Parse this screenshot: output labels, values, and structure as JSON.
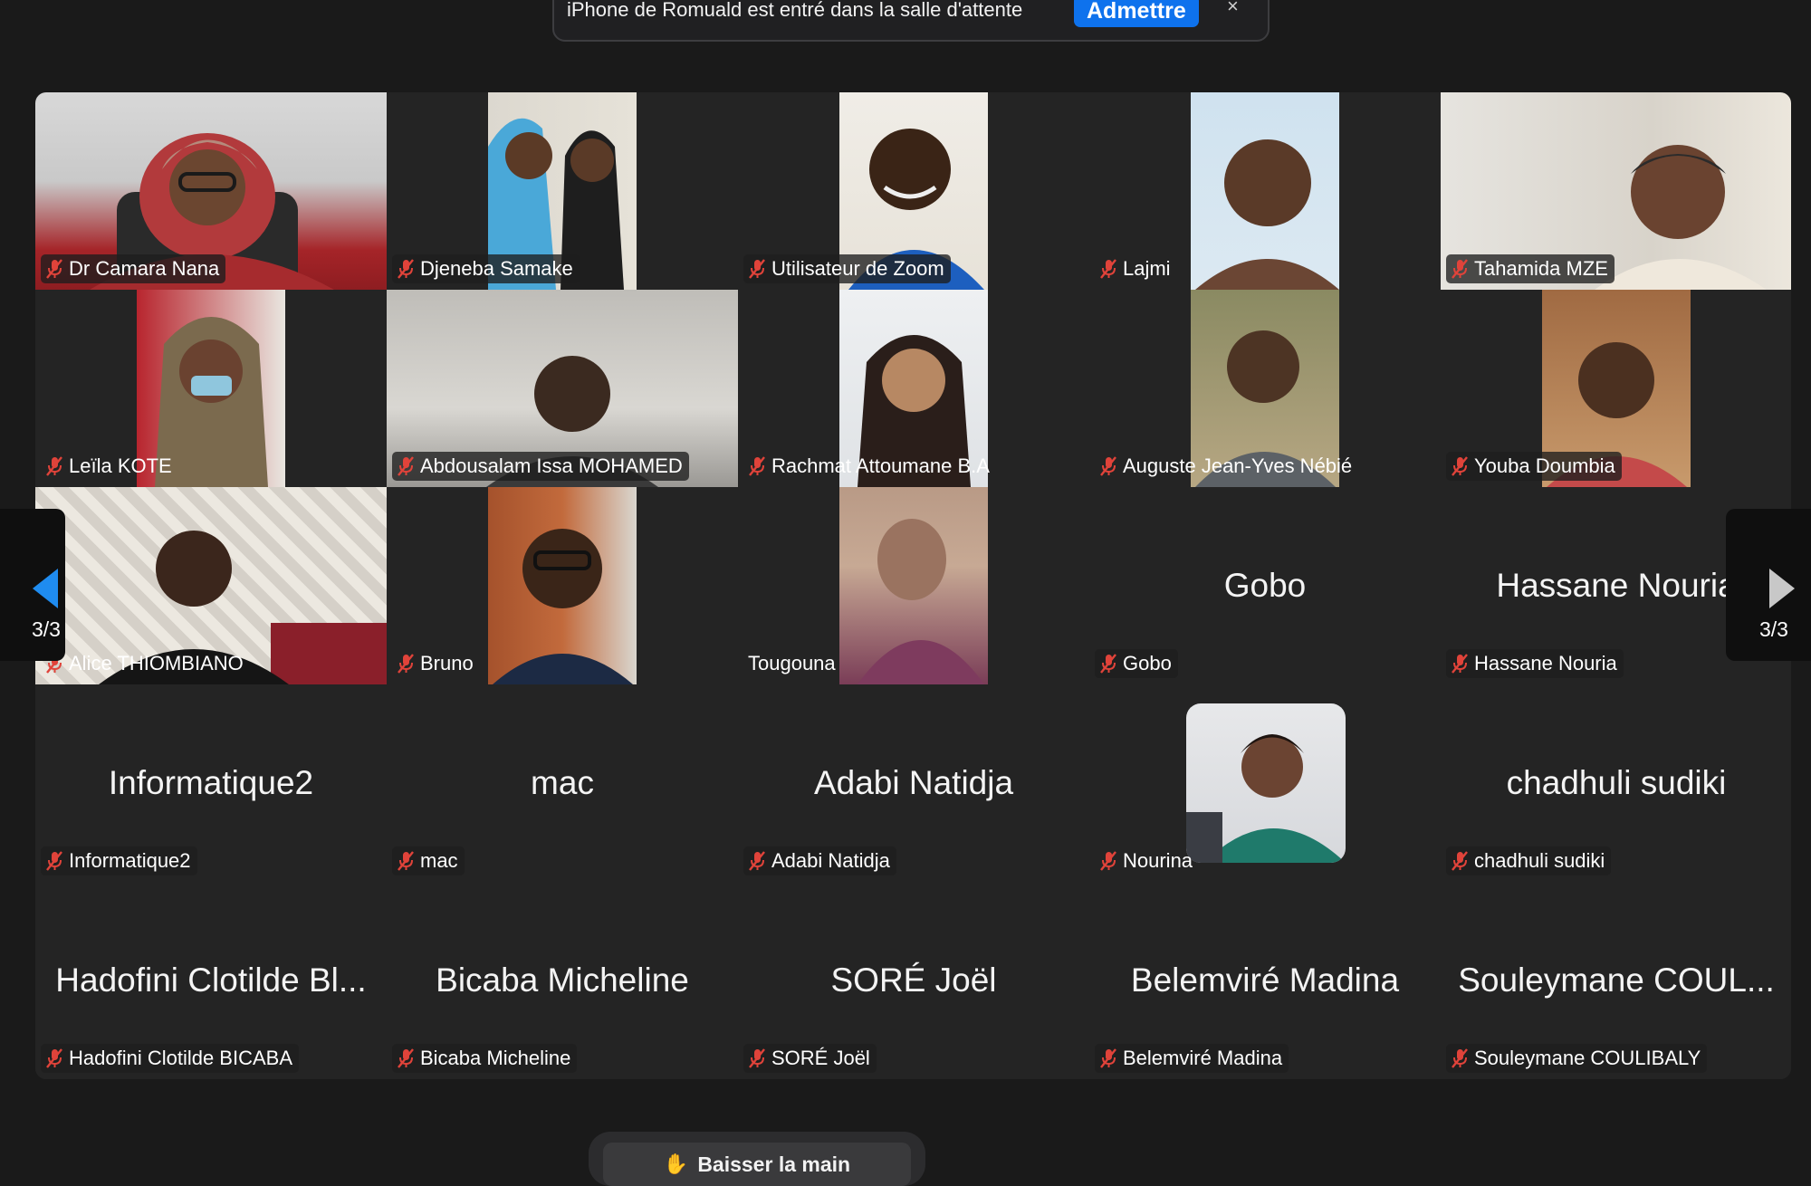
{
  "banner": {
    "message": "iPhone de Romuald est entré dans la salle d'attente",
    "admit_label": "Admettre",
    "close_glyph": "×"
  },
  "navigation": {
    "page_left": "3/3",
    "page_right": "3/3",
    "prev_icon": "triangle-left-icon",
    "next_icon": "triangle-right-icon"
  },
  "participants": [
    {
      "name": "Dr Camara Nana",
      "display": "video",
      "muted": true
    },
    {
      "name": "Djeneba Samake",
      "display": "video",
      "muted": true
    },
    {
      "name": "Utilisateur de Zoom",
      "display": "video",
      "muted": true
    },
    {
      "name": "Lajmi",
      "display": "video",
      "muted": true
    },
    {
      "name": "Tahamida MZE",
      "display": "video",
      "muted": true
    },
    {
      "name": "Leïla KOTE",
      "display": "video",
      "muted": true
    },
    {
      "name": "Abdousalam Issa MOHAMED",
      "display": "video",
      "muted": true
    },
    {
      "name": "Rachmat Attoumane B.A",
      "display": "video",
      "muted": true
    },
    {
      "name": "Auguste Jean-Yves Nébié",
      "display": "video",
      "muted": true
    },
    {
      "name": "Youba Doumbia",
      "display": "video",
      "muted": true
    },
    {
      "name": "Alice THIOMBIANO",
      "display": "video",
      "muted": true
    },
    {
      "name": "Bruno",
      "display": "video",
      "muted": true
    },
    {
      "name": "Tougouna",
      "display": "video",
      "muted": false
    },
    {
      "name": "Gobo",
      "display": "name",
      "big_name": "Gobo",
      "muted": true
    },
    {
      "name": "Hassane Nouria",
      "display": "name",
      "big_name": "Hassane Nouria",
      "muted": true
    },
    {
      "name": "Informatique2",
      "display": "name",
      "big_name": "Informatique2",
      "muted": true
    },
    {
      "name": "mac",
      "display": "name",
      "big_name": "mac",
      "muted": true
    },
    {
      "name": "Adabi Natidja",
      "display": "name",
      "big_name": "Adabi Natidja",
      "muted": true
    },
    {
      "name": "Nourina",
      "display": "avatar",
      "muted": true
    },
    {
      "name": "chadhuli sudiki",
      "display": "name",
      "big_name": "chadhuli sudiki",
      "muted": true
    },
    {
      "name": "Hadofini Clotilde BICABA",
      "display": "name",
      "big_name": "Hadofini Clotilde Bl...",
      "muted": true
    },
    {
      "name": "Bicaba Micheline",
      "display": "name",
      "big_name": "Bicaba Micheline",
      "muted": true
    },
    {
      "name": "SORÉ Joël",
      "display": "name",
      "big_name": "SORÉ Joël",
      "muted": true
    },
    {
      "name": "Belemviré Madina",
      "display": "name",
      "big_name": "Belemviré Madina",
      "muted": true
    },
    {
      "name": "Souleymane COULIBALY",
      "display": "name",
      "big_name": "Souleymane COUL...",
      "muted": true
    }
  ],
  "raise_hand_label": "Baisser la main",
  "colors": {
    "background": "#1a1a1a",
    "tile": "#242424",
    "accent": "#0e72ed",
    "muted_icon": "#e0433a",
    "nav_arrow_active": "#1f8cf0",
    "nav_arrow_inactive": "#c8c8c8"
  }
}
